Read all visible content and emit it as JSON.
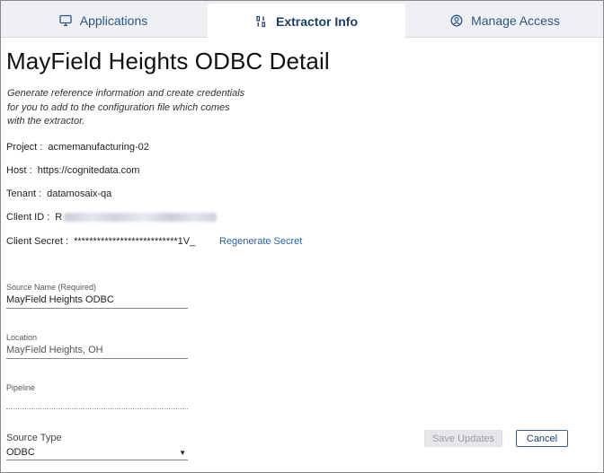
{
  "tabs": [
    {
      "label": "Applications",
      "icon": "monitor-icon"
    },
    {
      "label": "Extractor Info",
      "icon": "binary-icon"
    },
    {
      "label": "Manage Access",
      "icon": "user-circle-icon"
    }
  ],
  "title": "MayField Heights ODBC Detail",
  "description": "Generate reference information and create credentials for you to add to the configuration file which comes with the extractor.",
  "info": {
    "project_label": "Project :",
    "project_value": "acmemanufacturing-02",
    "host_label": "Host :",
    "host_value": "https://cognitedata.com",
    "tenant_label": "Tenant :",
    "tenant_value": "datamosaix-qa",
    "client_id_label": "Client ID :",
    "client_id_value": "R",
    "client_secret_label": "Client Secret :",
    "client_secret_value": "***************************1V_",
    "regenerate_label": "Regenerate Secret"
  },
  "form": {
    "source_name_label": "Source Name (Required)",
    "source_name_value": "MayField Heights ODBC",
    "location_label": "Location",
    "location_value": "MayField Heights, OH",
    "pipeline_label": "Pipeline",
    "pipeline_value": "",
    "source_type_label": "Source Type",
    "source_type_value": "ODBC"
  },
  "buttons": {
    "save_label": "Save Updates",
    "cancel_label": "Cancel"
  },
  "colors": {
    "accent": "#1f4e85",
    "link": "#2a5fa5",
    "tab_bar_bg": "#eef0f4"
  }
}
